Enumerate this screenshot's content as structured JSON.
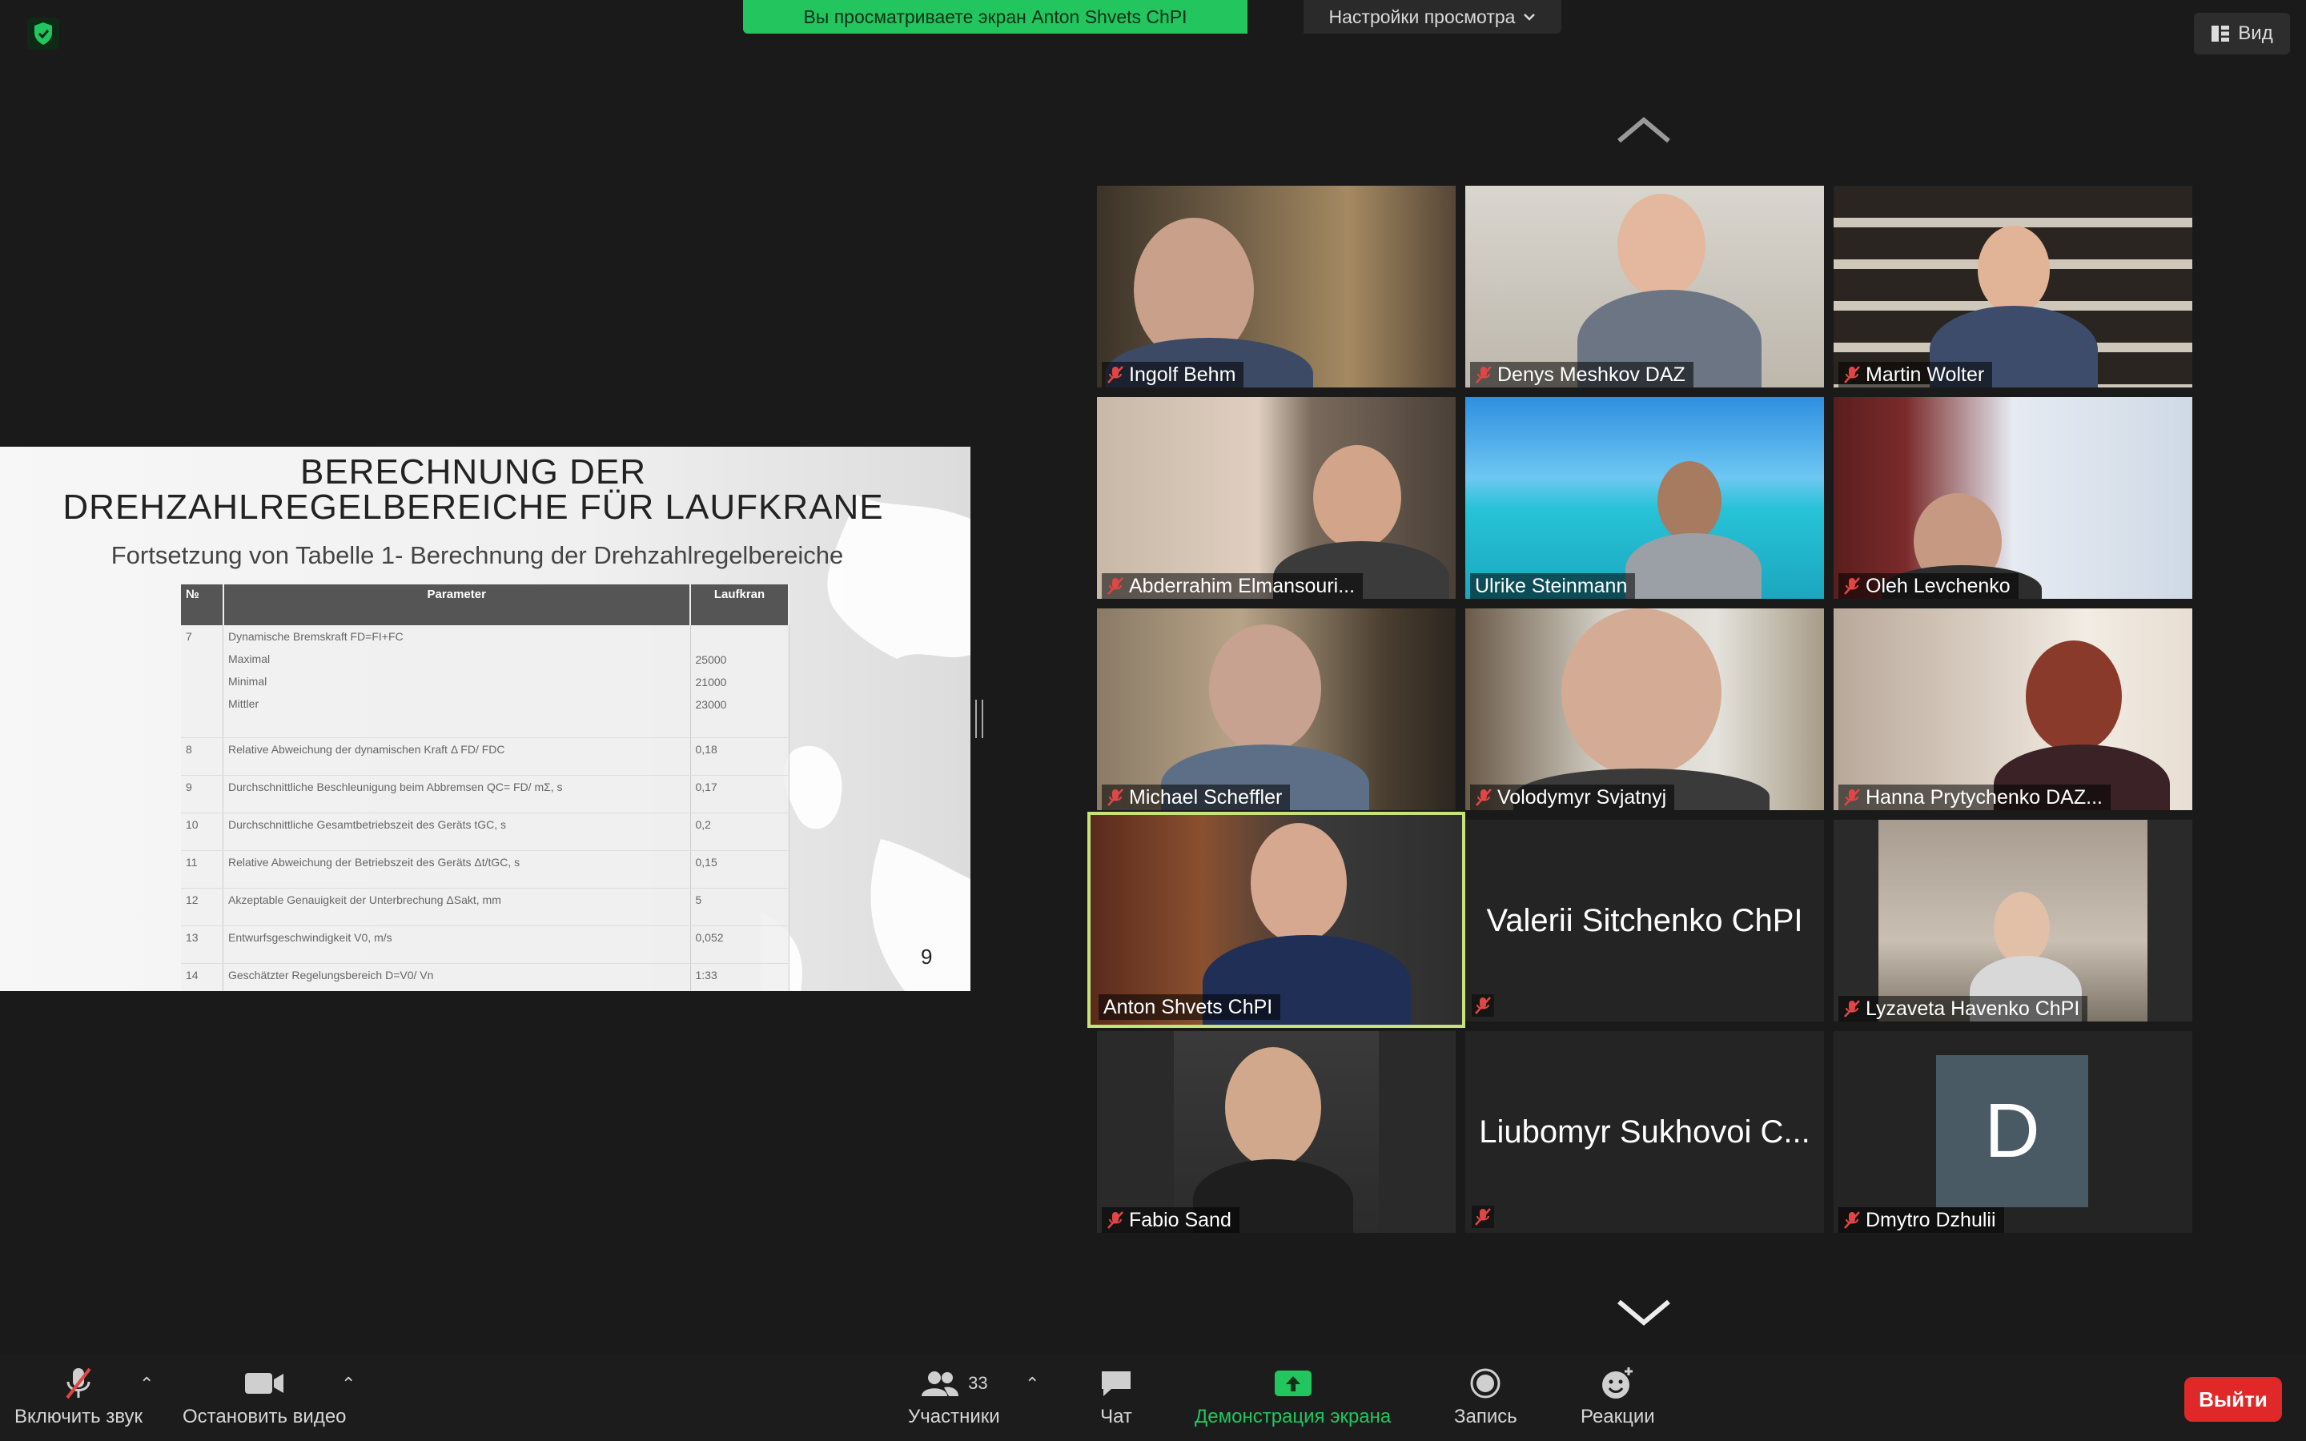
{
  "top": {
    "share_banner": "Вы просматриваете экран Anton Shvets ChPI",
    "view_options": "Настройки просмотра",
    "view_button": "Вид"
  },
  "slide": {
    "title": "BERECHNUNG DER\nDREHZAHLREGELBEREICHE FÜR LAUFKRANE",
    "subtitle": "Fortsetzung von Tabelle 1- Berechnung der Drehzahlregelbereiche",
    "headers": [
      "№",
      "Parameter",
      "Laufkran"
    ],
    "rows": [
      {
        "n": "7",
        "param": "Dynamische Bremskraft FD=FI+FC",
        "value": "",
        "sub": [
          {
            "label": "Maximal",
            "value": "25000"
          },
          {
            "label": "Minimal",
            "value": "21000"
          },
          {
            "label": "Mittler",
            "value": "23000"
          }
        ]
      },
      {
        "n": "8",
        "param": "Relative Abweichung der dynamischen Kraft Δ FD/ FDC",
        "value": "0,18"
      },
      {
        "n": "9",
        "param": "Durchschnittliche Beschleunigung beim Abbremsen QC= FD/ mΣ, s",
        "value": "0,17"
      },
      {
        "n": "10",
        "param": "Durchschnittliche Gesamtbetriebszeit des Geräts tGC, s",
        "value": "0,2"
      },
      {
        "n": "11",
        "param": "Relative Abweichung der Betriebszeit des Geräts Δt/tGC, s",
        "value": "0,15"
      },
      {
        "n": "12",
        "param": "Akzeptable Genauigkeit der Unterbrechung   ΔSakt, mm",
        "value": "5"
      },
      {
        "n": "13",
        "param": "Entwurfsgeschwindigkeit V0, m/s",
        "value": "0,052"
      },
      {
        "n": "14",
        "param": "Geschätzter Regelungsbereich D=V0/ Vn",
        "value": "1:33"
      }
    ],
    "page": "9"
  },
  "participants": [
    {
      "name": "Ingolf Behm",
      "muted": true,
      "video": true
    },
    {
      "name": "Denys Meshkov DAZ",
      "muted": true,
      "video": true
    },
    {
      "name": "Martin Wolter",
      "muted": true,
      "video": true
    },
    {
      "name": "Abderrahim Elmansouri...",
      "muted": true,
      "video": true
    },
    {
      "name": "Ulrike Steinmann",
      "muted": false,
      "video": true
    },
    {
      "name": "Oleh Levchenko",
      "muted": true,
      "video": true
    },
    {
      "name": "Michael Scheffler",
      "muted": true,
      "video": true
    },
    {
      "name": "Volodymyr Svjatnyj",
      "muted": true,
      "video": true
    },
    {
      "name": "Hanna Prytychenko DAZ...",
      "muted": true,
      "video": true
    },
    {
      "name": "Anton Shvets ChPI",
      "muted": false,
      "video": true,
      "active": true
    },
    {
      "name": "Valerii Sitchenko ChPI",
      "muted": true,
      "video": false
    },
    {
      "name": "Lyzaveta Havenko ChPI",
      "muted": true,
      "video": true
    },
    {
      "name": "Fabio Sand",
      "muted": true,
      "video": true
    },
    {
      "name": "Liubomyr Sukhovoi C...",
      "muted": true,
      "video": false
    },
    {
      "name": "Dmytro Dzhulii",
      "muted": true,
      "video": false,
      "avatar_letter": "D"
    }
  ],
  "toolbar": {
    "unmute": "Включить звук",
    "stop_video": "Остановить видео",
    "participants": "Участники",
    "participants_count": "33",
    "chat": "Чат",
    "share_screen": "Демонстрация экрана",
    "record": "Запись",
    "reactions": "Реакции",
    "leave": "Выйти"
  },
  "colors": {
    "share_green": "#22c55e",
    "active_border": "#c6e27a",
    "leave_red": "#e02828"
  }
}
